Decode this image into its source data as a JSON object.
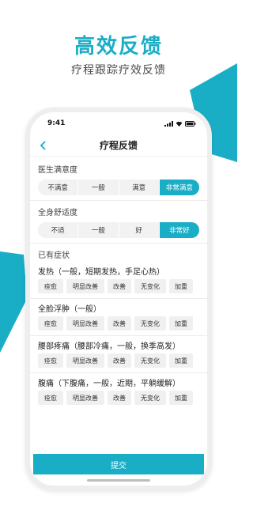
{
  "hero": {
    "title": "高效反馈",
    "subtitle": "疗程跟踪疗效反馈"
  },
  "status_bar": {
    "time": "9:41"
  },
  "nav": {
    "title": "疗程反馈",
    "back_icon": "chevron-left-icon"
  },
  "doctor_satisfaction": {
    "label": "医生满意度",
    "options": [
      "不满意",
      "一般",
      "满意",
      "非常满意"
    ],
    "selected": "非常满意"
  },
  "body_comfort": {
    "label": "全身舒适度",
    "options": [
      "不适",
      "一般",
      "好",
      "非常好"
    ],
    "selected": "非常好"
  },
  "symptoms": {
    "label": "已有症状",
    "items": [
      {
        "name": "发热（一般，短期发热，手足心热）",
        "options": [
          "痊愈",
          "明显改善",
          "改善",
          "无变化",
          "加重"
        ]
      },
      {
        "name": "全脸浮肿（一般）",
        "options": [
          "痊愈",
          "明显改善",
          "改善",
          "无变化",
          "加重"
        ]
      },
      {
        "name": "腰部疼痛（腰部冷痛，一般，换季高发）",
        "options": [
          "痊愈",
          "明显改善",
          "改善",
          "无变化",
          "加重"
        ]
      },
      {
        "name": "腹痛（下腹痛，一般，近期，平躺缓解）",
        "options": [
          "痊愈",
          "明显改善",
          "改善",
          "无变化",
          "加重"
        ]
      }
    ]
  },
  "submit": {
    "label": "提交"
  },
  "colors": {
    "accent": "#1aaec6",
    "chip_bg": "#f0f0f0",
    "segment_bg": "#f2f2f2"
  }
}
